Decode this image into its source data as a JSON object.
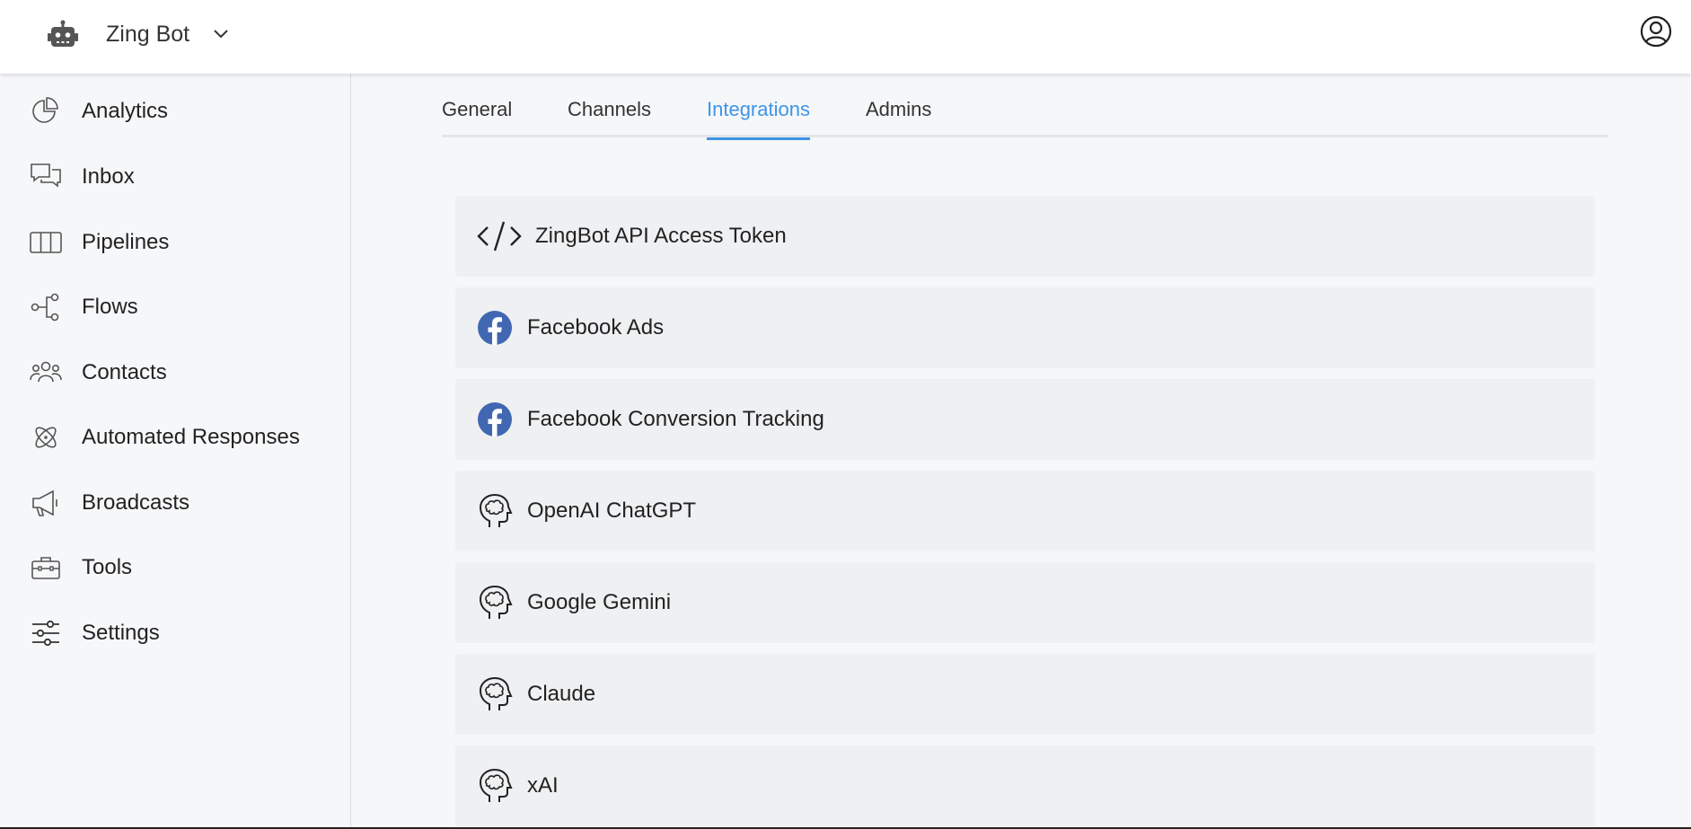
{
  "header": {
    "bot_name": "Zing Bot",
    "bot_icon": "robot-icon",
    "dropdown_icon": "chevron-down-icon",
    "profile_icon": "user-circle-icon"
  },
  "sidebar": {
    "items": [
      {
        "label": "Analytics",
        "icon": "pie-chart-icon"
      },
      {
        "label": "Inbox",
        "icon": "chat-bubbles-icon"
      },
      {
        "label": "Pipelines",
        "icon": "columns-icon"
      },
      {
        "label": "Flows",
        "icon": "flow-nodes-icon"
      },
      {
        "label": "Contacts",
        "icon": "users-icon"
      },
      {
        "label": "Automated Responses",
        "icon": "atom-icon"
      },
      {
        "label": "Broadcasts",
        "icon": "megaphone-icon"
      },
      {
        "label": "Tools",
        "icon": "toolbox-icon"
      },
      {
        "label": "Settings",
        "icon": "sliders-icon"
      }
    ]
  },
  "tabs": [
    {
      "label": "General",
      "active": false
    },
    {
      "label": "Channels",
      "active": false
    },
    {
      "label": "Integrations",
      "active": true
    },
    {
      "label": "Admins",
      "active": false
    }
  ],
  "integrations": [
    {
      "label": "ZingBot API Access Token",
      "icon": "code-icon"
    },
    {
      "label": "Facebook Ads",
      "icon": "facebook-icon"
    },
    {
      "label": "Facebook Conversion Tracking",
      "icon": "facebook-icon"
    },
    {
      "label": "OpenAI ChatGPT",
      "icon": "brain-head-icon"
    },
    {
      "label": "Google Gemini",
      "icon": "brain-head-icon"
    },
    {
      "label": "Claude",
      "icon": "brain-head-icon"
    },
    {
      "label": "xAI",
      "icon": "brain-head-icon"
    }
  ],
  "colors": {
    "accent": "#3d95e8",
    "facebook": "#4267b2",
    "background": "#f6f7f9",
    "card": "#eff0f2"
  }
}
